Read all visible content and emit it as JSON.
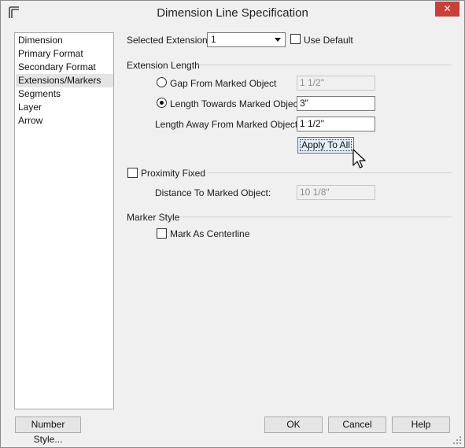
{
  "window": {
    "title": "Dimension Line Specification",
    "close_label": "✕"
  },
  "nav": {
    "items": [
      "Dimension",
      "Primary Format",
      "Secondary Format",
      "Extensions/Markers",
      "Segments",
      "Layer",
      "Arrow"
    ],
    "selected_index": 3
  },
  "selected_extension": {
    "label": "Selected Extension:",
    "value": "1"
  },
  "use_default": {
    "label": "Use Default",
    "checked": false
  },
  "extension_length": {
    "heading": "Extension Length",
    "gap_from": {
      "label": "Gap From Marked Object",
      "value": "1 1/2\"",
      "selected": false
    },
    "length_towards": {
      "label": "Length Towards Marked Object",
      "value": "3\"",
      "selected": true
    },
    "length_away": {
      "label": "Length Away From Marked Object:",
      "value": "1 1/2\""
    },
    "apply_to_all": "Apply To All"
  },
  "proximity": {
    "label": "Proximity Fixed",
    "checked": false,
    "distance_label": "Distance To Marked Object:",
    "distance_value": "10 1/8\""
  },
  "marker_style": {
    "heading": "Marker Style",
    "centerline_label": "Mark As Centerline",
    "centerline_checked": false
  },
  "buttons": {
    "number_style": "Number Style...",
    "ok": "OK",
    "cancel": "Cancel",
    "help": "Help"
  }
}
